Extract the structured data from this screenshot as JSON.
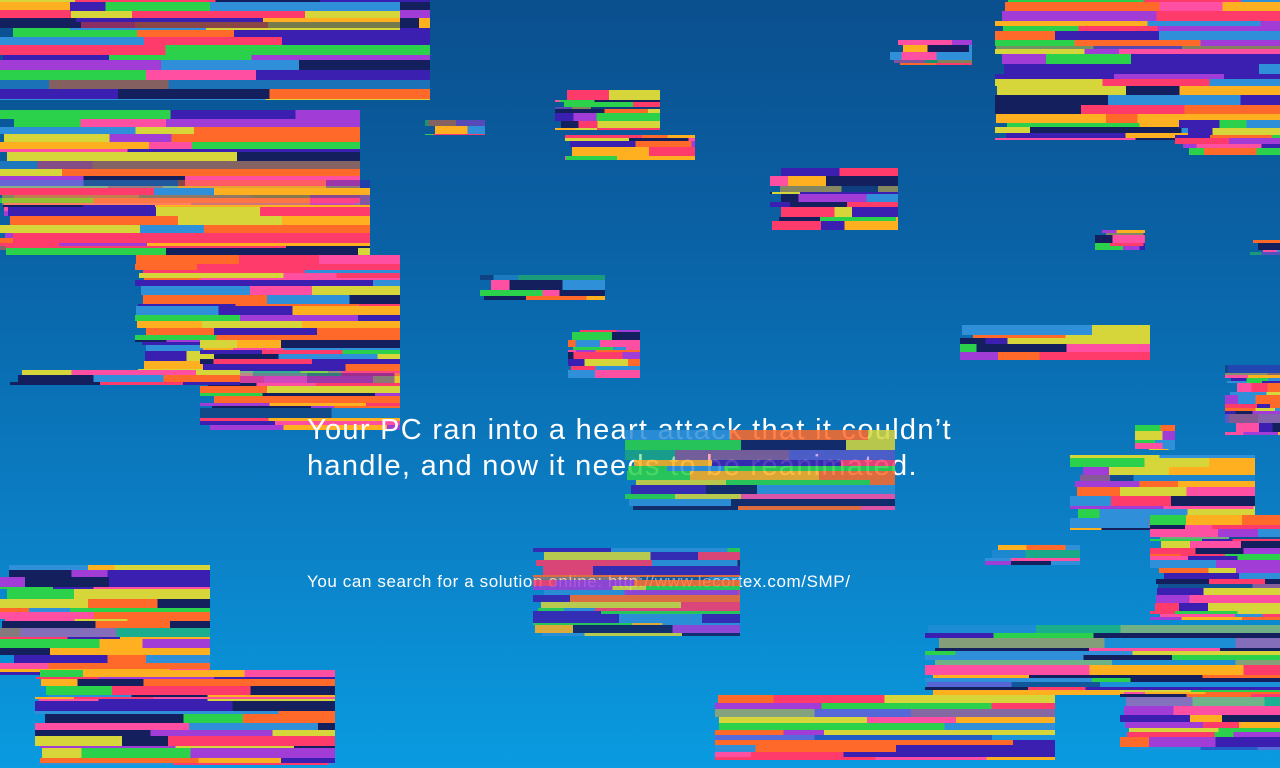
{
  "screen": {
    "message_line_1": "Your PC ran into a heart attack that it couldn’t",
    "message_line_2": "handle, and now it needs to be reanimated.",
    "search_prefix": "You can search for a solution online:",
    "search_url": "http://www.lecortex.com/SMP/"
  },
  "colors": {
    "background_top": "#0a4f8e",
    "background_bottom": "#0a9be0",
    "text": "#ffffff",
    "glitch_palette": [
      "#ff3b6b",
      "#ff6a2a",
      "#3a1fb0",
      "#2bd14a",
      "#a23cd6",
      "#ffb020",
      "#14205e",
      "#ff4fa3",
      "#2f8fd8",
      "#d6d63a"
    ]
  }
}
